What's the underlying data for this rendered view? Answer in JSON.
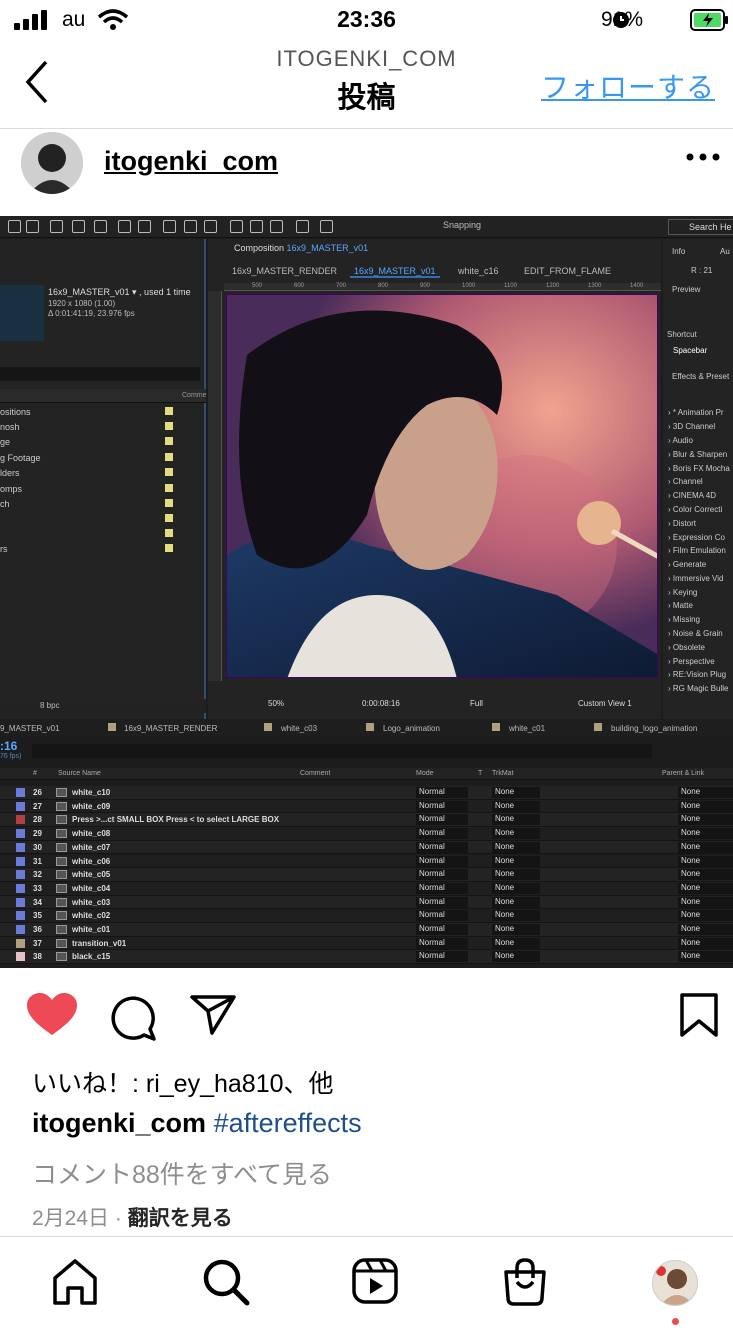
{
  "status_bar": {
    "carrier": "au",
    "time": "23:36",
    "battery": "91%"
  },
  "header": {
    "account": "ITOGENKI_COM",
    "title": "投稿",
    "follow_label": "フォローする"
  },
  "post_author": {
    "username": "itogenki_com"
  },
  "ae": {
    "snapping": "Snapping",
    "search_help": "Search He",
    "project_item_name": "16x9_MASTER_v01 ▾ , used 1 time",
    "project_item_meta": [
      "1920 x 1080 (1.00)",
      "Δ 0:01:41:19, 23.976 fps"
    ],
    "project_header_comment": "Comme",
    "project_folders": [
      "ositions",
      "nosh",
      "ge",
      "g Footage",
      "lders",
      "omps",
      "ch",
      "",
      "",
      "rs"
    ],
    "project_bpc": "8 bpc",
    "comp_label_prefix": "Composition",
    "comp_label_name": "16x9_MASTER_v01",
    "comp_tabs": [
      "16x9_MASTER_RENDER",
      "16x9_MASTER_v01",
      "white_c16",
      "EDIT_FROM_FLAME"
    ],
    "ruler_ticks": [
      "500",
      "600",
      "700",
      "800",
      "900",
      "1000",
      "1100",
      "1200",
      "1300",
      "1400"
    ],
    "comp_footer": {
      "zoom": "50%",
      "timecode": "0:00:08:16",
      "resolution": "Full",
      "view": "Custom View 1"
    },
    "info": {
      "tab1": "Info",
      "tab2": "Au",
      "r": "R : 21"
    },
    "preview": {
      "title": "Preview",
      "shortcut_label": "Shortcut",
      "shortcut_value": "Spacebar"
    },
    "effects_title": "Effects & Preset",
    "effects": [
      "* Animation Pr",
      "3D Channel",
      "Audio",
      "Blur & Sharpen",
      "Boris FX Mocha",
      "Channel",
      "CINEMA 4D",
      "Color Correcti",
      "Distort",
      "Expression Co",
      "Film Emulation",
      "Generate",
      "Immersive Vid",
      "Keying",
      "Matte",
      "Missing",
      "Noise & Grain",
      "Obsolete",
      "Perspective",
      "RE:Vision Plug",
      "RG Magic Bulle"
    ],
    "timeline_tabs": [
      "9_MASTER_v01",
      "16x9_MASTER_RENDER",
      "white_c03",
      "Logo_animation",
      "white_c01",
      "building_logo_animation"
    ],
    "timeline_time": ":16",
    "timeline_fps": "76 fps)",
    "columns": {
      "num": "#",
      "source": "Source Name",
      "comment": "Comment",
      "mode": "Mode",
      "t": "T",
      "trkmat": "TrkMat",
      "parent": "Parent & Link"
    },
    "layers": [
      {
        "num": "26",
        "name": "white_c10",
        "mode": "Normal",
        "trk": "None",
        "parent": "None",
        "color": "#6b7bd8"
      },
      {
        "num": "27",
        "name": "white_c09",
        "mode": "Normal",
        "trk": "None",
        "parent": "None",
        "color": "#6b7bd8"
      },
      {
        "num": "28",
        "name": "Press >...ct SMALL BOX Press < to select LARGE BOX",
        "mode": "Normal",
        "trk": "None",
        "parent": "None",
        "color": "#b34040"
      },
      {
        "num": "29",
        "name": "white_c08",
        "mode": "Normal",
        "trk": "None",
        "parent": "None",
        "color": "#6b7bd8"
      },
      {
        "num": "30",
        "name": "white_c07",
        "mode": "Normal",
        "trk": "None",
        "parent": "None",
        "color": "#6b7bd8"
      },
      {
        "num": "31",
        "name": "white_c06",
        "mode": "Normal",
        "trk": "None",
        "parent": "None",
        "color": "#6b7bd8"
      },
      {
        "num": "32",
        "name": "white_c05",
        "mode": "Normal",
        "trk": "None",
        "parent": "None",
        "color": "#6b7bd8"
      },
      {
        "num": "33",
        "name": "white_c04",
        "mode": "Normal",
        "trk": "None",
        "parent": "None",
        "color": "#6b7bd8"
      },
      {
        "num": "34",
        "name": "white_c03",
        "mode": "Normal",
        "trk": "None",
        "parent": "None",
        "color": "#6b7bd8"
      },
      {
        "num": "35",
        "name": "white_c02",
        "mode": "Normal",
        "trk": "None",
        "parent": "None",
        "color": "#6b7bd8"
      },
      {
        "num": "36",
        "name": "white_c01",
        "mode": "Normal",
        "trk": "None",
        "parent": "None",
        "color": "#6b7bd8"
      },
      {
        "num": "37",
        "name": "transition_v01",
        "mode": "Normal",
        "trk": "None",
        "parent": "None",
        "color": "#b29f80"
      },
      {
        "num": "38",
        "name": "black_c15",
        "mode": "Normal",
        "trk": "None",
        "parent": "None",
        "color": "#e8c0c8"
      }
    ]
  },
  "actions": {
    "like_icon": "heart-icon",
    "comment_icon": "comment-icon",
    "share_icon": "send-icon",
    "save_icon": "bookmark-icon",
    "like_color": "#ed4956"
  },
  "likes_text": "いいね！: ri_ey_ha810、他",
  "caption": {
    "username": "itogenki_com",
    "hashtag": "#aftereffects"
  },
  "comments_link": "コメント88件をすべて見る",
  "date": "2月24日",
  "date_sep": "·",
  "translate_label": "翻訳を見る",
  "bottom_nav": [
    "home-icon",
    "search-icon",
    "reels-icon",
    "shop-icon",
    "profile-avatar"
  ]
}
